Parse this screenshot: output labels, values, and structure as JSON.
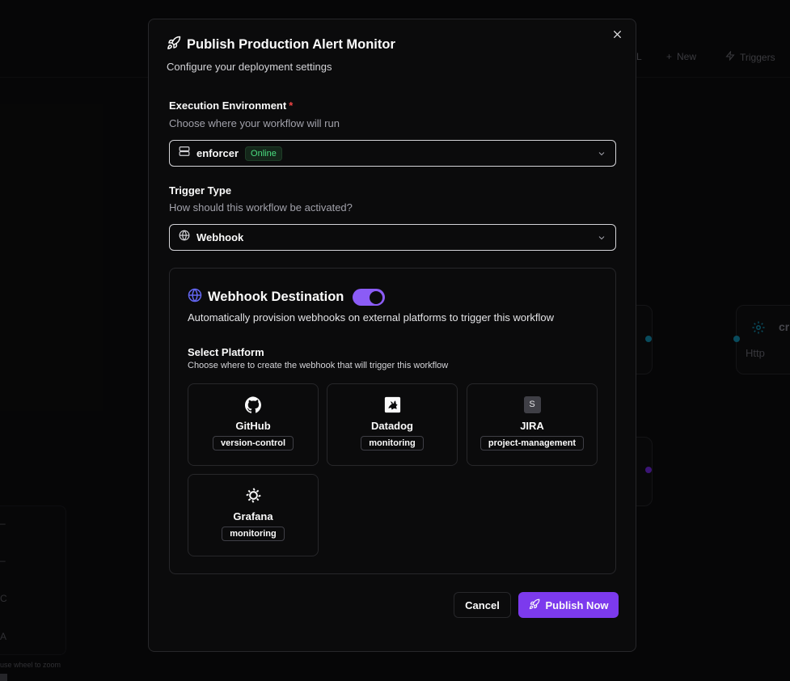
{
  "background": {
    "toolbar": {
      "partial_label": "L",
      "new_label": "New",
      "triggers_label": "Triggers"
    },
    "node_right": {
      "title_partial": "cr",
      "subtitle": "Http"
    },
    "zoom_items": [
      "–",
      "–",
      "C",
      "A"
    ],
    "zoom_hint": "use wheel to zoom"
  },
  "modal": {
    "title": "Publish Production Alert Monitor",
    "subtitle": "Configure your deployment settings",
    "execution": {
      "label": "Execution Environment",
      "required_marker": "*",
      "description": "Choose where your workflow will run",
      "selected": "enforcer",
      "status": "Online"
    },
    "trigger": {
      "label": "Trigger Type",
      "description": "How should this workflow be activated?",
      "selected": "Webhook"
    },
    "webhook": {
      "title": "Webhook Destination",
      "enabled": true,
      "description": "Automatically provision webhooks on external platforms to trigger this workflow",
      "select_label": "Select Platform",
      "select_description": "Choose where to create the webhook that will trigger this workflow",
      "platforms": [
        {
          "name": "GitHub",
          "tag": "version-control",
          "icon": "github-icon"
        },
        {
          "name": "Datadog",
          "tag": "monitoring",
          "icon": "datadog-icon"
        },
        {
          "name": "JIRA",
          "tag": "project-management",
          "icon": "jira-icon",
          "icon_letter": "S"
        },
        {
          "name": "Grafana",
          "tag": "monitoring",
          "icon": "grafana-icon"
        }
      ]
    },
    "buttons": {
      "cancel": "Cancel",
      "publish": "Publish Now"
    }
  },
  "colors": {
    "accent": "#7c3aed",
    "toggle": "#8b5cf6",
    "online": "#4ade80",
    "required": "#ef4444",
    "globe": "#6366f1"
  }
}
